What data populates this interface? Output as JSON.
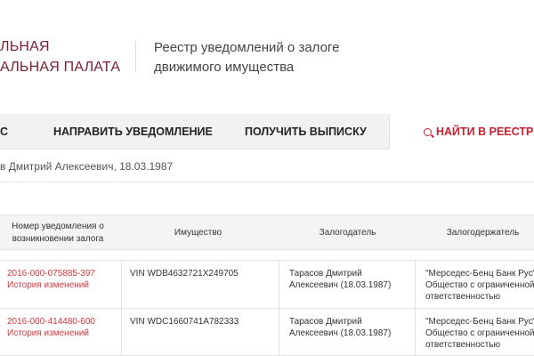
{
  "header": {
    "org_line1": "ЛЬНАЯ",
    "org_line2": "АЛЬНАЯ ПАЛАТА",
    "registry_line1": "Реестр уведомлений о залоге",
    "registry_line2": "движимого имущества"
  },
  "nav": {
    "fragment": "С",
    "send_notice": "НАПРАВИТЬ УВЕДОМЛЕНИЕ",
    "get_extract": "ПОЛУЧИТЬ ВЫПИСКУ",
    "search_registry": "НАЙТИ В РЕЕСТРЕ"
  },
  "query": {
    "text": "в Дмитрий Алексеевич, 18.03.1987"
  },
  "table": {
    "headers": {
      "number_line1": "Номер уведомления о",
      "number_line2": "возникновении залога",
      "property": "Имущество",
      "pledgor": "Залогодатель",
      "pledgee": "Залогодержатель"
    },
    "rows": [
      {
        "number": "2016-000-075885-397",
        "history": "История изменений",
        "property": "VIN WDB4632721X249705",
        "pledgor_line1": "Тарасов Дмитрий",
        "pledgor_line2": "Алексеевич (18.03.1987)",
        "pledgee_line1": "\"Мерседес-Бенц Банк Рус\"",
        "pledgee_line2": "Общество с ограниченной",
        "pledgee_line3": "ответственностью"
      },
      {
        "number": "2016-000-414480-600",
        "history": "История изменений",
        "property": "VIN WDC1660741A782333",
        "pledgor_line1": "Тарасов Дмитрий",
        "pledgor_line2": "Алексеевич (18.03.1987)",
        "pledgee_line1": "\"Мерседес-Бенц Банк Рус\"",
        "pledgee_line2": "Общество с ограниченной",
        "pledgee_line3": "ответственностью"
      }
    ]
  },
  "colors": {
    "brand": "#7a1f33",
    "accent": "#c8202f",
    "link": "#d9363e"
  },
  "icons": {
    "search": "search-icon"
  }
}
